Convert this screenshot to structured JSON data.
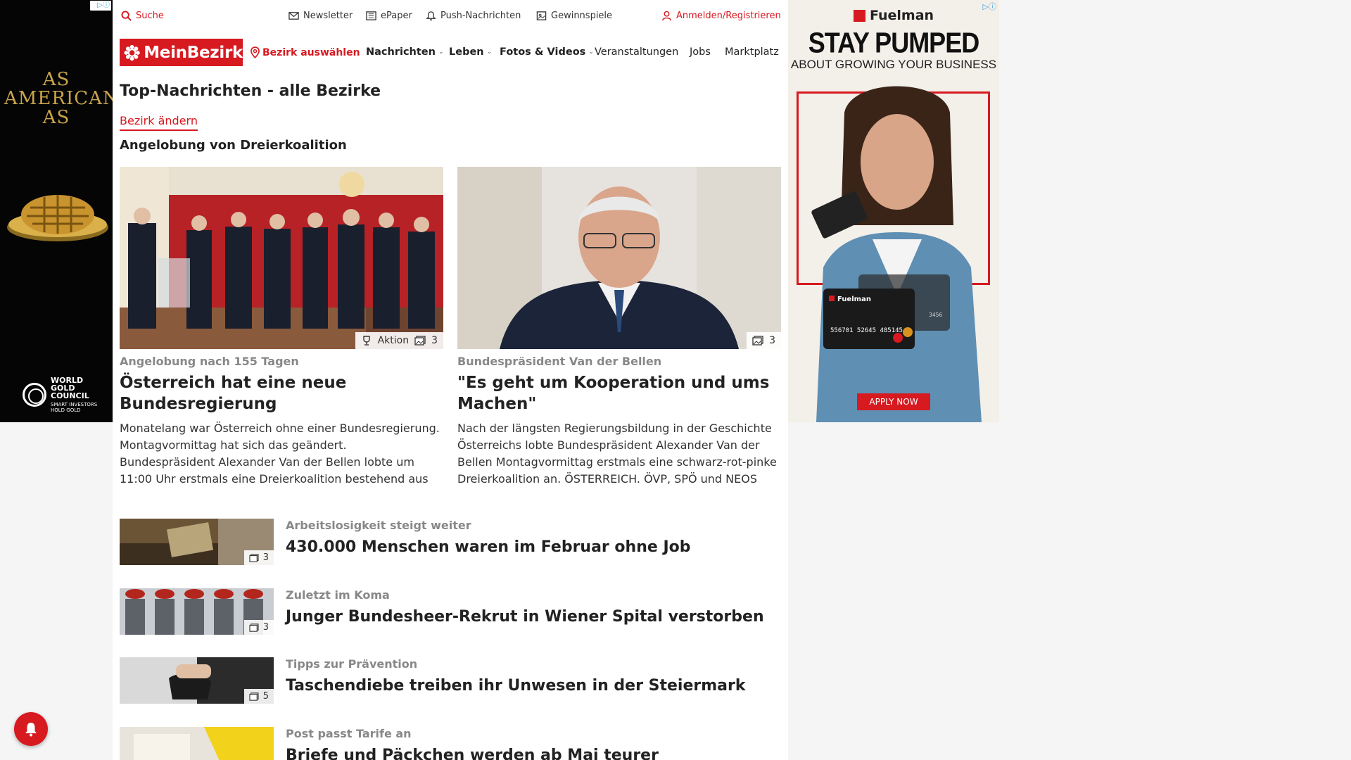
{
  "colors": {
    "brand": "#d71920",
    "text": "#222222",
    "kicker": "#888888"
  },
  "ads": {
    "left": {
      "headline": "AS AMERICAN AS",
      "logo_text": "WORLD GOLD COUNCIL",
      "logo_tagline": "SMART INVESTORS HOLD GOLD"
    },
    "right": {
      "brand": "Fuelman",
      "headline": "STAY PUMPED",
      "subheadline": "ABOUT GROWING YOUR BUSINESS",
      "card_brand": "Fuelman",
      "card_number": "556701 52645 485145",
      "card_last": "3456",
      "cta": "APPLY NOW"
    }
  },
  "topbar": {
    "search": "Suche",
    "newsletter": "Newsletter",
    "epaper": "ePaper",
    "push": "Push-Nachrichten",
    "gewinnspiele": "Gewinnspiele",
    "login": "Anmelden/Registrieren"
  },
  "nav": {
    "logo": "MeinBezirk",
    "bezirk": "Bezirk auswählen",
    "items": [
      {
        "label": "Nachrichten",
        "dropdown": true
      },
      {
        "label": "Leben",
        "dropdown": true
      },
      {
        "label": "Fotos & Videos",
        "dropdown": true
      },
      {
        "label": "Veranstaltungen",
        "dropdown": false
      },
      {
        "label": "Jobs",
        "dropdown": false
      },
      {
        "label": "Marktplatz",
        "dropdown": false
      }
    ]
  },
  "page": {
    "title": "Top-Nachrichten - alle Bezirke",
    "bezirk_link": "Bezirk ändern",
    "section_title": "Angelobung von Dreierkoalition"
  },
  "big_teasers": [
    {
      "kicker": "Angelobung nach 155 Tagen",
      "title": "Österreich hat eine neue Bundesregierung",
      "text": "Monatelang war Österreich ohne einer Bundesregierung. Montagvormittag hat sich das geändert. Bundespräsident Alexander Van der Bellen lobte um 11:00 Uhr erstmals eine Dreierkoalition bestehend aus ÖVP, SP...",
      "badge_label": "Aktion",
      "photo_count": "3"
    },
    {
      "kicker": "Bundespräsident Van der Bellen",
      "title": "\"Es geht um Kooperation und ums Machen\"",
      "text": "Nach der längsten Regierungsbildung in der Geschichte Österreichs lobte Bundespräsident Alexander Van der Bellen Montagvormittag erstmals eine schwarz-rot-pinke Dreierkoalition an. ÖSTERREICH. ÖVP, SPÖ und NEOS bilde...",
      "photo_count": "3"
    }
  ],
  "small_teasers": [
    {
      "kicker": "Arbeitslosigkeit steigt weiter",
      "title": "430.000 Menschen waren im Februar ohne Job",
      "photo_count": "3"
    },
    {
      "kicker": "Zuletzt im Koma",
      "title": "Junger Bundesheer-Rekrut in Wiener Spital verstorben",
      "photo_count": "3"
    },
    {
      "kicker": "Tipps zur Prävention",
      "title": "Taschendiebe treiben ihr Unwesen in der Steiermark",
      "photo_count": "5"
    },
    {
      "kicker": "Post passt Tarife an",
      "title": "Briefe und Päckchen werden ab Mai teurer",
      "photo_count": ""
    }
  ]
}
